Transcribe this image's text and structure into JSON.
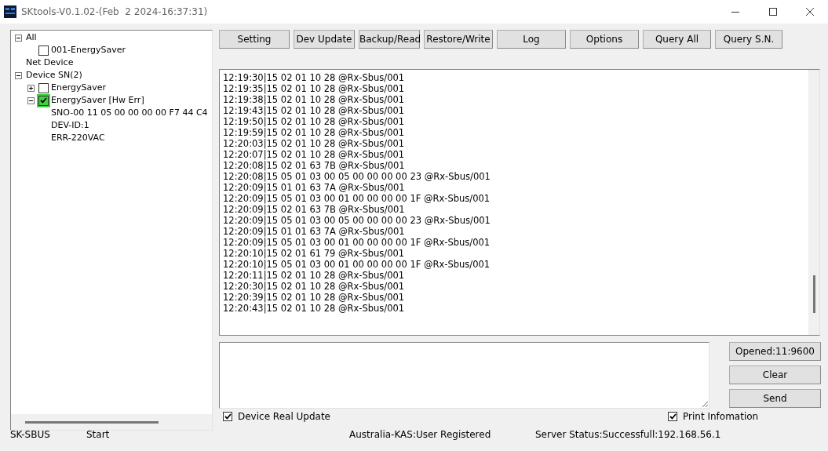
{
  "window": {
    "title": "SKtools-V0.1.02-(Feb  2 2024-16:37:31)"
  },
  "tree": [
    {
      "label": "All",
      "expanded": true,
      "children": [
        {
          "label": "001-EnergySaver",
          "checked": false
        }
      ]
    },
    {
      "label": "Net Device"
    },
    {
      "label": "Device SN(2)",
      "expanded": true,
      "children": [
        {
          "label": "EnergySaver",
          "expanded": false,
          "checked": false
        },
        {
          "label": "EnergySaver [Hw Err]",
          "expanded": true,
          "checked": true,
          "children": [
            {
              "label": "SNO-00 11 05 00 00 00 00 F7 44 C4"
            },
            {
              "label": "DEV-ID:1"
            },
            {
              "label": "ERR-220VAC"
            }
          ]
        }
      ]
    }
  ],
  "toolbar": [
    "Setting",
    "Dev Update",
    "Backup/Read",
    "Restore/Write",
    "Log",
    "Options",
    "Query All",
    "Query S.N."
  ],
  "log_lines": [
    "12:19:30|15 02 01 10 28 @Rx-Sbus/001",
    "12:19:35|15 02 01 10 28 @Rx-Sbus/001",
    "12:19:38|15 02 01 10 28 @Rx-Sbus/001",
    "12:19:43|15 02 01 10 28 @Rx-Sbus/001",
    "12:19:50|15 02 01 10 28 @Rx-Sbus/001",
    "12:19:59|15 02 01 10 28 @Rx-Sbus/001",
    "12:20:03|15 02 01 10 28 @Rx-Sbus/001",
    "12:20:07|15 02 01 10 28 @Rx-Sbus/001",
    "12:20:08|15 02 01 63 7B @Rx-Sbus/001",
    "12:20:08|15 05 01 03 00 05 00 00 00 00 23 @Rx-Sbus/001",
    "12:20:09|15 01 01 63 7A @Rx-Sbus/001",
    "12:20:09|15 05 01 03 00 01 00 00 00 00 1F @Rx-Sbus/001",
    "12:20:09|15 02 01 63 7B @Rx-Sbus/001",
    "12:20:09|15 05 01 03 00 05 00 00 00 00 23 @Rx-Sbus/001",
    "12:20:09|15 01 01 63 7A @Rx-Sbus/001",
    "12:20:09|15 05 01 03 00 01 00 00 00 00 1F @Rx-Sbus/001",
    "12:20:10|15 02 01 61 79 @Rx-Sbus/001",
    "12:20:10|15 05 01 03 00 01 00 00 00 00 1F @Rx-Sbus/001",
    "12:20:11|15 02 01 10 28 @Rx-Sbus/001",
    "12:20:30|15 02 01 10 28 @Rx-Sbus/001",
    "12:20:39|15 02 01 10 28 @Rx-Sbus/001",
    "12:20:43|15 02 01 10 28 @Rx-Sbus/001"
  ],
  "side_buttons": [
    "Opened:11:9600",
    "Clear",
    "Send"
  ],
  "options": [
    {
      "label": "Device Real Update",
      "checked": true
    },
    {
      "label": "Print Infomation",
      "checked": true
    }
  ],
  "status_bar": [
    "SK-SBUS",
    "Start",
    "Australia-KAS:User Registered",
    "Server Status:Successfull:192.168.56.1"
  ]
}
